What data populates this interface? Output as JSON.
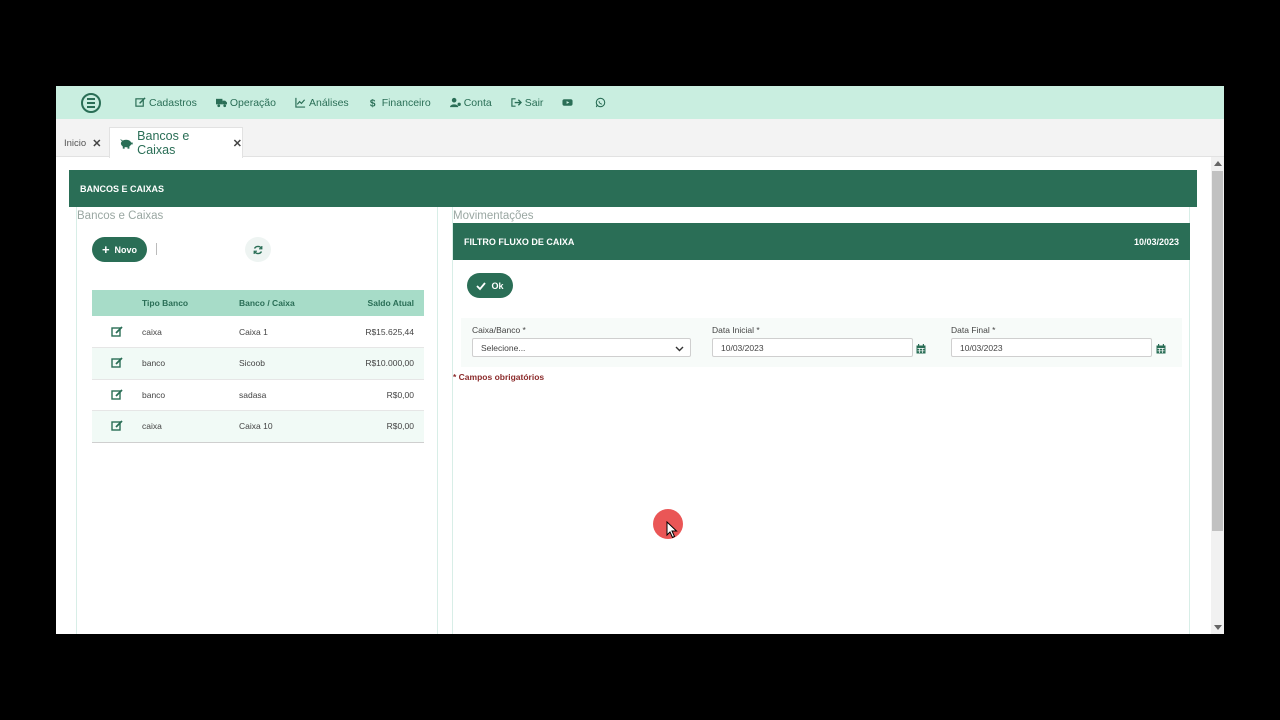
{
  "nav": {
    "items": [
      {
        "label": "Cadastros",
        "icon": "edit-icon"
      },
      {
        "label": "Operação",
        "icon": "truck-icon"
      },
      {
        "label": "Análises",
        "icon": "line-chart-icon"
      },
      {
        "label": "Financeiro",
        "icon": "dollar-icon"
      },
      {
        "label": "Conta",
        "icon": "user-gear-icon"
      },
      {
        "label": "Sair",
        "icon": "sign-out-icon"
      }
    ]
  },
  "tabs": {
    "home_label": "Inicio",
    "active_label": "Bancos e Caixas",
    "close_glyph": "✕"
  },
  "page": {
    "header": "BANCOS E CAIXAS"
  },
  "left": {
    "title": "Bancos e Caixas",
    "novo_label": "Novo",
    "table": {
      "headers": [
        "",
        "Tipo Banco",
        "Banco / Caixa",
        "Saldo Atual"
      ],
      "rows": [
        {
          "tipo": "caixa",
          "nome": "Caixa 1",
          "saldo": "R$15.625,44"
        },
        {
          "tipo": "banco",
          "nome": "Sicoob",
          "saldo": "R$10.000,00"
        },
        {
          "tipo": "banco",
          "nome": "sadasa",
          "saldo": "R$0,00"
        },
        {
          "tipo": "caixa",
          "nome": "Caixa 10",
          "saldo": "R$0,00"
        }
      ]
    }
  },
  "right": {
    "title": "Movimentações",
    "filter_header": "FILTRO FLUXO DE CAIXA",
    "filter_date": "10/03/2023",
    "ok_label": "Ok",
    "fields": {
      "caixa_label": "Caixa/Banco *",
      "caixa_value": "Selecione...",
      "data_inicial_label": "Data Inicial *",
      "data_inicial_value": "10/03/2023",
      "data_final_label": "Data Final *",
      "data_final_value": "10/03/2023"
    },
    "required_note": "* Campos obrigatórios"
  },
  "colors": {
    "primary": "#2a6e56",
    "nav_bg": "#c9eee0",
    "table_head": "#a7dcc8",
    "required": "#8b2a2a"
  }
}
